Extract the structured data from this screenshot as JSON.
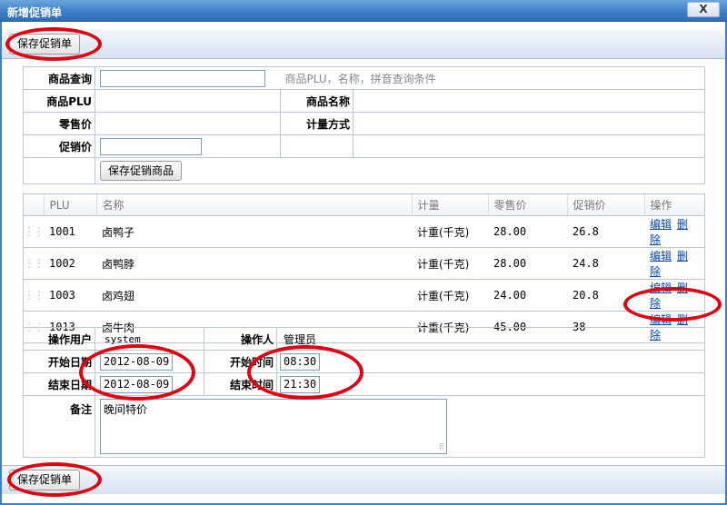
{
  "window": {
    "title": "新增促销单",
    "close_label": "X"
  },
  "toolbar": {
    "save_label": "保存促销单"
  },
  "query": {
    "search_label": "商品查询",
    "search_value": "",
    "search_hint": "商品PLU，名称，拼音查询条件",
    "plu_label": "商品PLU",
    "name_label": "商品名称",
    "price_label": "零售价",
    "measure_label": "计量方式",
    "promo_label": "促销价",
    "promo_value": "",
    "save_item_label": "保存促销商品"
  },
  "grid": {
    "headers": [
      "PLU",
      "名称",
      "计量",
      "零售价",
      "促销价",
      "操作"
    ],
    "rows": [
      {
        "plu": "1001",
        "name": "卤鸭子",
        "unit": "计重(千克)",
        "price": "28.00",
        "promo": "26.8"
      },
      {
        "plu": "1002",
        "name": "卤鸭脖",
        "unit": "计重(千克)",
        "price": "28.00",
        "promo": "24.8"
      },
      {
        "plu": "1003",
        "name": "卤鸡翅",
        "unit": "计重(千克)",
        "price": "24.00",
        "promo": "20.8"
      },
      {
        "plu": "1013",
        "name": "卤牛肉",
        "unit": "计重(千克)",
        "price": "45.00",
        "promo": "38"
      }
    ],
    "edit_label": "编辑",
    "delete_label": "删除"
  },
  "info": {
    "user_label": "操作用户",
    "user_value": "system",
    "operator_label": "操作人",
    "operator_value": "管理员",
    "start_date_label": "开始日期",
    "start_date_value": "2012-08-09",
    "start_time_label": "开始时间",
    "start_time_value": "08:30",
    "end_date_label": "结束日期",
    "end_date_value": "2012-08-09",
    "end_time_label": "结束时间",
    "end_time_value": "21:30",
    "note_label": "备注",
    "note_value": "晚间特价"
  },
  "colors": {
    "title_bar": "#3f7fc8",
    "highlight": "#e0000f",
    "link": "#0645ad"
  }
}
